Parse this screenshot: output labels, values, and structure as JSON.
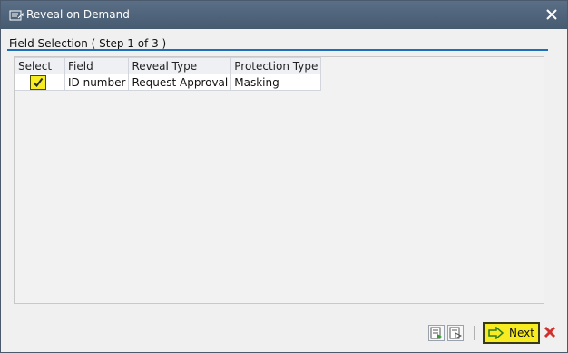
{
  "window": {
    "title": "Reveal on Demand"
  },
  "group": {
    "title": "Field Selection ( Step 1 of 3 )"
  },
  "table": {
    "headers": {
      "select": "Select",
      "field": "Field",
      "reveal_type": "Reveal Type",
      "protection_type": "Protection Type"
    },
    "rows": [
      {
        "selected": true,
        "field": "ID number",
        "reveal_type": "Request Approval",
        "protection_type": "Masking"
      }
    ]
  },
  "footer": {
    "next_label": "Next"
  },
  "icons": {
    "title": "dialog-icon",
    "close": "close-icon",
    "footer_1": "table-settings-icon",
    "footer_2": "table-export-icon",
    "next": "arrow-right-icon",
    "cancel": "cancel-icon"
  },
  "colors": {
    "titlebar": "#4f6379",
    "highlight": "#f6ec21",
    "accent_rule": "#1f6fb8",
    "cancel": "#d0312d",
    "arrow": "#2e9e2e"
  }
}
